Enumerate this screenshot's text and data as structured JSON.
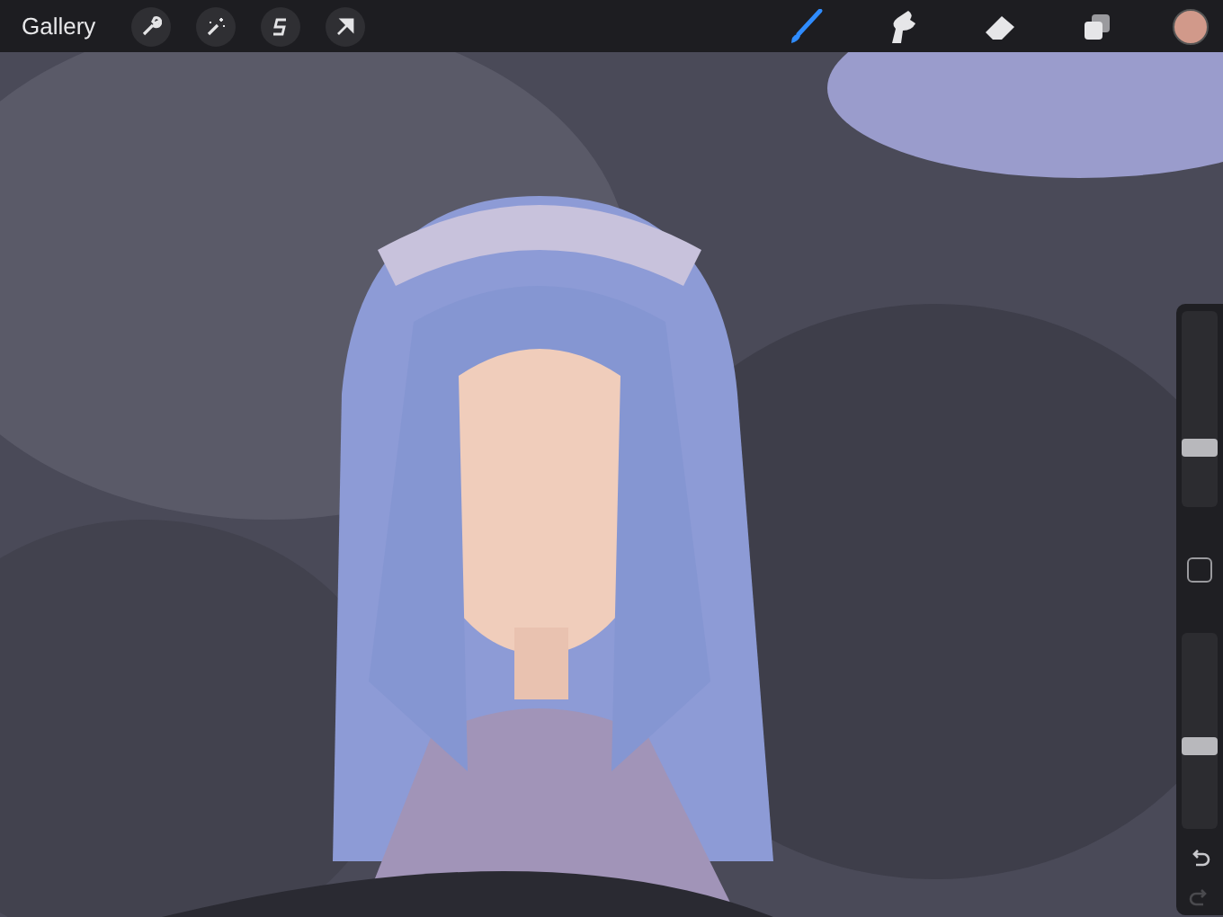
{
  "toolbar": {
    "gallery": "Gallery",
    "left_tools": [
      {
        "kind": "wrench"
      },
      {
        "kind": "wand"
      },
      {
        "kind": "selection"
      },
      {
        "kind": "arrow"
      }
    ],
    "right_tools": [
      {
        "kind": "brush",
        "selected": true
      },
      {
        "kind": "smudge",
        "selected": false
      },
      {
        "kind": "eraser",
        "selected": false
      },
      {
        "kind": "layers",
        "selected": false
      }
    ],
    "color": {
      "color": "#d1998a"
    }
  },
  "sidebar": {
    "size_slider": {
      "level": 0.26
    },
    "opacity_slider": {
      "level": 0.38
    },
    "undo": {
      "disabled": false
    },
    "redo": {
      "disabled": true
    }
  }
}
